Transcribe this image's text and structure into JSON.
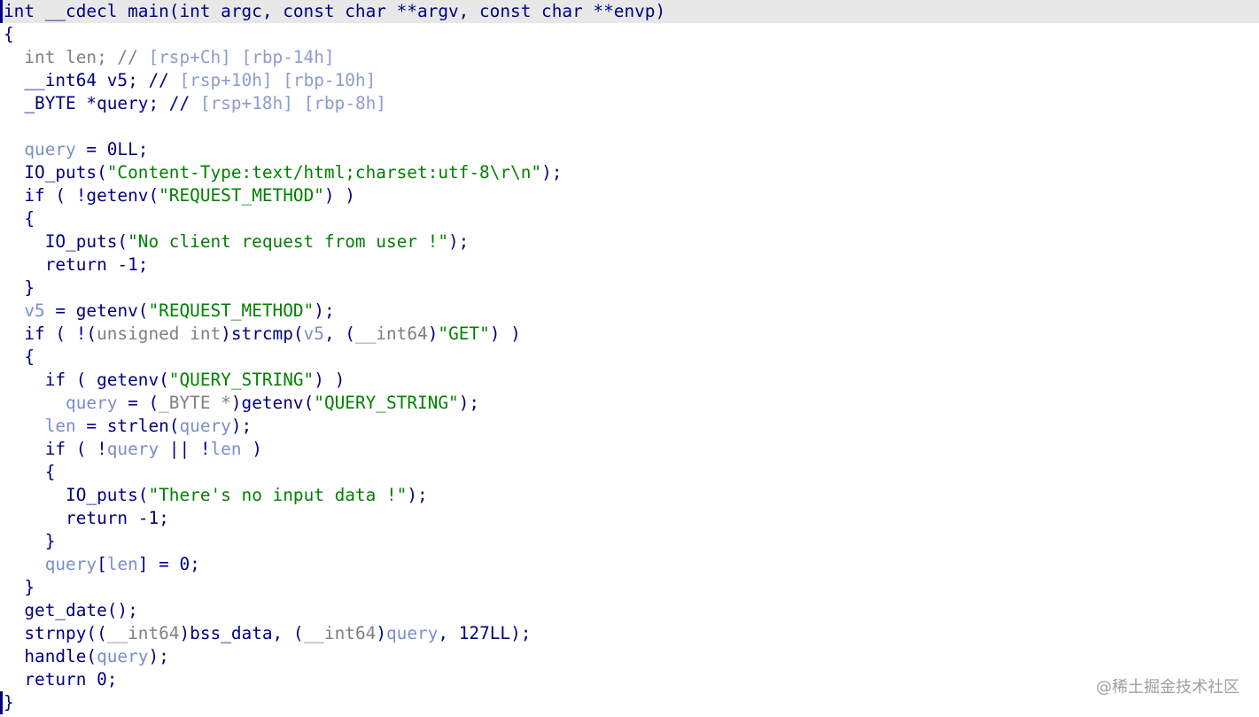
{
  "lines": [
    [
      {
        "t": "int __cdecl main(int argc, const char **argv, const char **envp)",
        "c": "kw"
      }
    ],
    [
      {
        "t": "{",
        "c": "punct"
      }
    ],
    [
      {
        "t": "  int len; ",
        "c": "gray"
      },
      {
        "t": "// ",
        "c": "gray"
      },
      {
        "t": "[rsp+Ch] [rbp-14h]",
        "c": "cmtdim"
      }
    ],
    [
      {
        "t": "  __int64 v5; ",
        "c": "kw"
      },
      {
        "t": "// ",
        "c": "kw"
      },
      {
        "t": "[rsp+10h] [rbp-10h]",
        "c": "cmtdim"
      }
    ],
    [
      {
        "t": "  _BYTE *query; ",
        "c": "kw"
      },
      {
        "t": "// ",
        "c": "kw"
      },
      {
        "t": "[rsp+18h] [rbp-8h]",
        "c": "cmtdim"
      }
    ],
    [
      {
        "t": "",
        "c": "kw"
      }
    ],
    [
      {
        "t": "  ",
        "c": "kw"
      },
      {
        "t": "query",
        "c": "var"
      },
      {
        "t": " = 0LL;",
        "c": "kw"
      }
    ],
    [
      {
        "t": "  IO_puts(",
        "c": "kw"
      },
      {
        "t": "\"Content-Type:text/html;charset:utf-8\\r\\n\"",
        "c": "str"
      },
      {
        "t": ");",
        "c": "kw"
      }
    ],
    [
      {
        "t": "  if ( !getenv(",
        "c": "kw"
      },
      {
        "t": "\"REQUEST_METHOD\"",
        "c": "str"
      },
      {
        "t": ") )",
        "c": "kw"
      }
    ],
    [
      {
        "t": "  {",
        "c": "kw"
      }
    ],
    [
      {
        "t": "    IO_puts(",
        "c": "kw"
      },
      {
        "t": "\"No client request from user !\"",
        "c": "str"
      },
      {
        "t": ");",
        "c": "kw"
      }
    ],
    [
      {
        "t": "    return -1;",
        "c": "kw"
      }
    ],
    [
      {
        "t": "  }",
        "c": "kw"
      }
    ],
    [
      {
        "t": "  ",
        "c": "kw"
      },
      {
        "t": "v5",
        "c": "var"
      },
      {
        "t": " = getenv(",
        "c": "kw"
      },
      {
        "t": "\"REQUEST_METHOD\"",
        "c": "str"
      },
      {
        "t": ");",
        "c": "kw"
      }
    ],
    [
      {
        "t": "  if ( !(",
        "c": "kw"
      },
      {
        "t": "unsigned int",
        "c": "gray"
      },
      {
        "t": ")strcmp(",
        "c": "kw"
      },
      {
        "t": "v5",
        "c": "var"
      },
      {
        "t": ", (",
        "c": "kw"
      },
      {
        "t": "__int64",
        "c": "gray"
      },
      {
        "t": ")",
        "c": "kw"
      },
      {
        "t": "\"GET\"",
        "c": "str"
      },
      {
        "t": ") )",
        "c": "kw"
      }
    ],
    [
      {
        "t": "  {",
        "c": "kw"
      }
    ],
    [
      {
        "t": "    if ( getenv(",
        "c": "kw"
      },
      {
        "t": "\"QUERY_STRING\"",
        "c": "str"
      },
      {
        "t": ") )",
        "c": "kw"
      }
    ],
    [
      {
        "t": "      ",
        "c": "kw"
      },
      {
        "t": "query",
        "c": "var"
      },
      {
        "t": " = (",
        "c": "kw"
      },
      {
        "t": "_BYTE *",
        "c": "gray"
      },
      {
        "t": ")getenv(",
        "c": "kw"
      },
      {
        "t": "\"QUERY_STRING\"",
        "c": "str"
      },
      {
        "t": ");",
        "c": "kw"
      }
    ],
    [
      {
        "t": "    ",
        "c": "kw"
      },
      {
        "t": "len",
        "c": "var"
      },
      {
        "t": " = strlen(",
        "c": "kw"
      },
      {
        "t": "query",
        "c": "var"
      },
      {
        "t": ");",
        "c": "kw"
      }
    ],
    [
      {
        "t": "    if ( !",
        "c": "kw"
      },
      {
        "t": "query",
        "c": "var"
      },
      {
        "t": " || !",
        "c": "kw"
      },
      {
        "t": "len",
        "c": "var"
      },
      {
        "t": " )",
        "c": "kw"
      }
    ],
    [
      {
        "t": "    {",
        "c": "kw"
      }
    ],
    [
      {
        "t": "      IO_puts(",
        "c": "kw"
      },
      {
        "t": "\"There's no input data !\"",
        "c": "str"
      },
      {
        "t": ");",
        "c": "kw"
      }
    ],
    [
      {
        "t": "      return -1;",
        "c": "kw"
      }
    ],
    [
      {
        "t": "    }",
        "c": "kw"
      }
    ],
    [
      {
        "t": "    ",
        "c": "kw"
      },
      {
        "t": "query",
        "c": "var"
      },
      {
        "t": "[",
        "c": "kw"
      },
      {
        "t": "len",
        "c": "var"
      },
      {
        "t": "] = 0;",
        "c": "kw"
      }
    ],
    [
      {
        "t": "  }",
        "c": "kw"
      }
    ],
    [
      {
        "t": "  get_date();",
        "c": "kw"
      }
    ],
    [
      {
        "t": "  strnpy((",
        "c": "kw"
      },
      {
        "t": "__int64",
        "c": "gray"
      },
      {
        "t": ")bss_data, (",
        "c": "kw"
      },
      {
        "t": "__int64",
        "c": "gray"
      },
      {
        "t": ")",
        "c": "kw"
      },
      {
        "t": "query",
        "c": "var"
      },
      {
        "t": ", 127LL);",
        "c": "kw"
      }
    ],
    [
      {
        "t": "  handle(",
        "c": "kw"
      },
      {
        "t": "query",
        "c": "var"
      },
      {
        "t": ");",
        "c": "kw"
      }
    ],
    [
      {
        "t": "  return 0;",
        "c": "kw"
      }
    ],
    [
      {
        "t": "}",
        "c": "kw"
      }
    ]
  ],
  "watermark": "@稀土掘金技术社区"
}
